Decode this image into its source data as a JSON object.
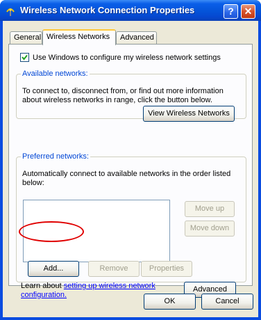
{
  "window": {
    "title": "Wireless Network Connection Properties",
    "help_glyph": "?",
    "close_glyph": "✕"
  },
  "tabs": [
    {
      "label": "General"
    },
    {
      "label": "Wireless Networks"
    },
    {
      "label": "Advanced"
    }
  ],
  "active_tab": "Wireless Networks",
  "use_windows_checkbox": {
    "label": "Use Windows to configure my wireless network settings",
    "checked": true
  },
  "available_networks": {
    "legend": "Available networks:",
    "description_line1": "To connect to, disconnect from, or find out more information",
    "description_line2": "about wireless networks in range, click the button below.",
    "view_button": "View Wireless Networks"
  },
  "preferred_networks": {
    "legend": "Preferred networks:",
    "description_line1": "Automatically connect to available networks in the order listed",
    "description_line2": "below:",
    "move_up": "Move up",
    "move_down": "Move down",
    "add": "Add...",
    "remove": "Remove",
    "properties": "Properties",
    "learn_prefix": "Learn about ",
    "learn_link_line1": "setting up wireless network",
    "learn_link_line2": "configuration.",
    "advanced": "Advanced"
  },
  "footer": {
    "ok": "OK",
    "cancel": "Cancel"
  },
  "colors": {
    "titlebar": "#0453d8",
    "dialog_face": "#ece9d8",
    "group_legend": "#0046d5",
    "annotation_circle": "#e00000"
  }
}
